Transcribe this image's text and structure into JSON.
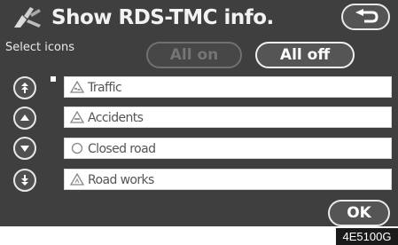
{
  "header": {
    "title": "Show RDS-TMC info.",
    "logo_icon": "rds-tmc-logo-icon",
    "return_icon": "return-arrow-icon"
  },
  "subtitle": "Select icons",
  "tabs": {
    "all_on": "All on",
    "all_off": "All off"
  },
  "items": [
    {
      "label": "Traffic",
      "icon": "traffic-icon",
      "button_icon": "double-arrow-up-icon",
      "selected": true
    },
    {
      "label": "Accidents",
      "icon": "accident-icon",
      "button_icon": "arrow-up-icon",
      "selected": false
    },
    {
      "label": "Closed road",
      "icon": "closed-road-icon",
      "button_icon": "arrow-down-icon",
      "selected": false
    },
    {
      "label": "Road works",
      "icon": "road-works-icon",
      "button_icon": "double-arrow-down-icon",
      "selected": false
    }
  ],
  "ok_label": "OK",
  "figure_code": "4E5100G",
  "colors": {
    "screen_bg": "#3f3f3f",
    "item_bg": "#ffffff",
    "text_light": "#f2f2f2",
    "item_text": "#555555"
  }
}
